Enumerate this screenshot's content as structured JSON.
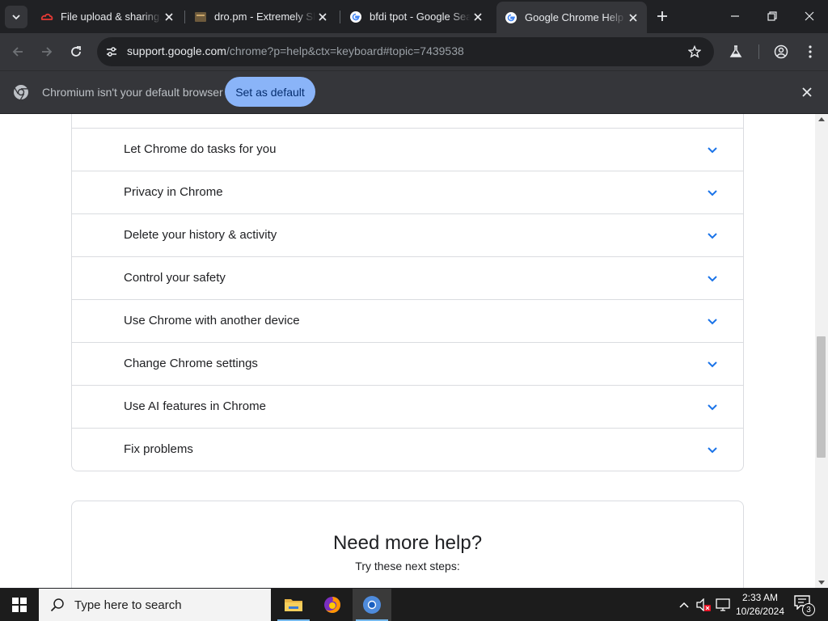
{
  "browser": {
    "tabs": [
      {
        "title": "File upload & sharing. ",
        "favicon": "red-cloud-icon",
        "active": false
      },
      {
        "title": "dro.pm - Extremely Sho",
        "favicon": "drop-icon",
        "active": false
      },
      {
        "title": "bfdi tpot - Google Sear",
        "favicon": "google-icon",
        "active": false
      },
      {
        "title": "Google Chrome Help",
        "favicon": "google-icon",
        "active": true
      }
    ],
    "address_bar": {
      "host": "support.google.com",
      "path": "/chrome?p=help&ctx=keyboard#topic=7439538"
    },
    "infobar": {
      "message": "Chromium isn't your default browser",
      "button": "Set as default"
    }
  },
  "page": {
    "topics": [
      {
        "label": ""
      },
      {
        "label": "Let Chrome do tasks for you"
      },
      {
        "label": "Privacy in Chrome"
      },
      {
        "label": "Delete your history & activity"
      },
      {
        "label": "Control your safety"
      },
      {
        "label": "Use Chrome with another device"
      },
      {
        "label": "Change Chrome settings"
      },
      {
        "label": "Use AI features in Chrome"
      },
      {
        "label": "Fix problems"
      }
    ],
    "help_card": {
      "heading": "Need more help?",
      "subheading": "Try these next steps:"
    }
  },
  "taskbar": {
    "search_placeholder": "Type here to search",
    "time": "2:33 AM",
    "date": "10/26/2024",
    "notification_count": "3"
  },
  "colors": {
    "accent_blue": "#8ab4f8",
    "chevron_blue": "#1a73e8",
    "link_blue": "#1a73e8"
  }
}
